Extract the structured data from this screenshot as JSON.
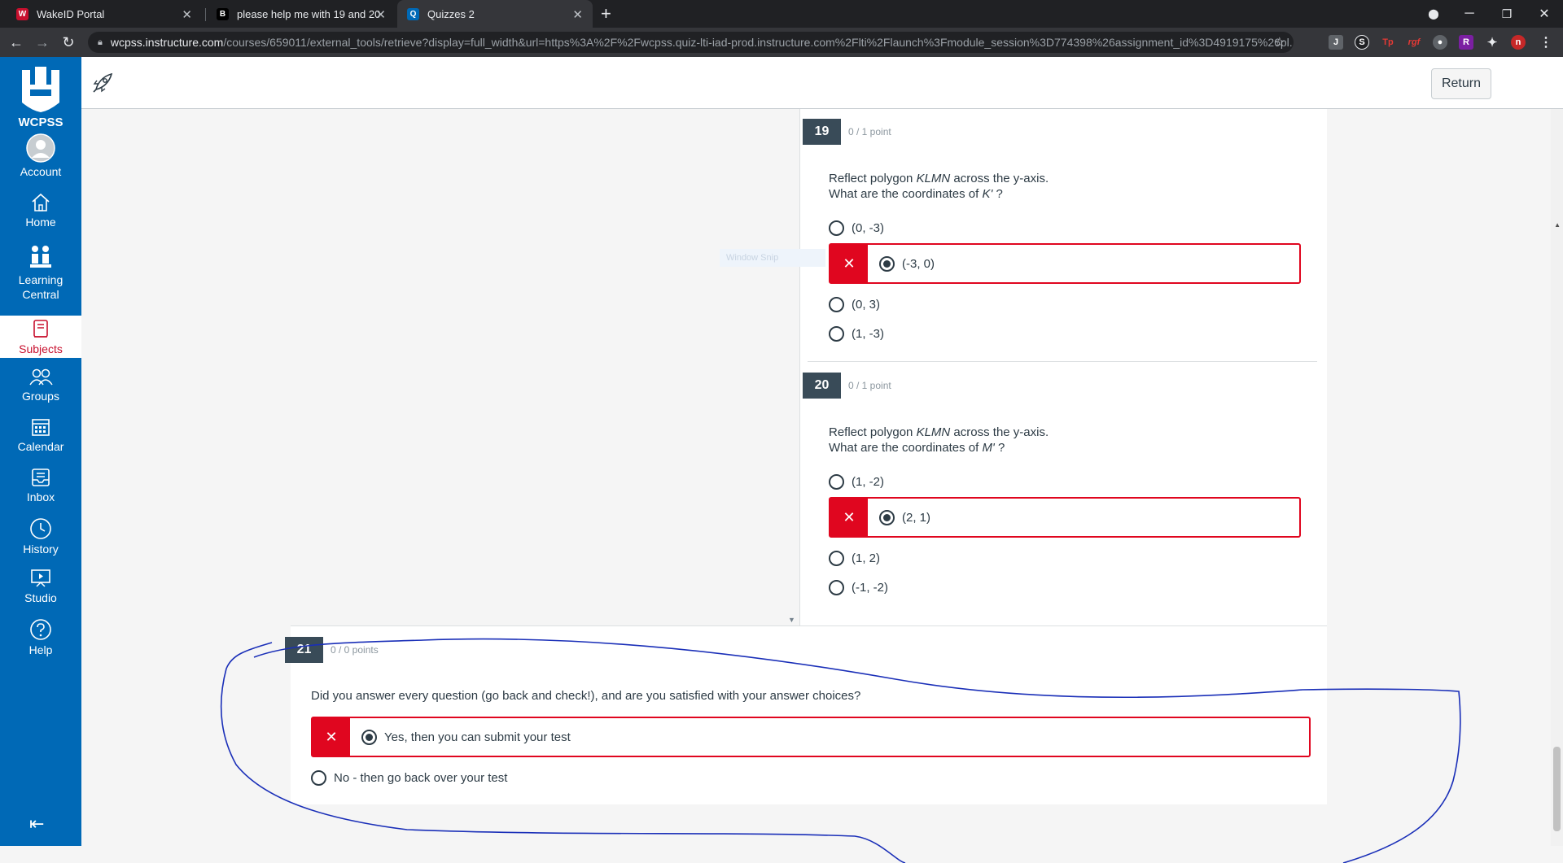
{
  "browser": {
    "tabs": [
      {
        "title": "WakeID Portal",
        "favicon": "W"
      },
      {
        "title": "please help me with 19 and 20 -",
        "favicon": "B"
      },
      {
        "title": "Quizzes 2",
        "favicon": "Q"
      }
    ],
    "url_host": "wcpss.instructure.com",
    "url_path": "/courses/659011/external_tools/retrieve?display=full_width&url=https%3A%2F%2Fwcpss.quiz-lti-iad-prod.instructure.com%2Flti%2Flaunch%3Fmodule_session%3D774398%26assignment_id%3D4919175%26pl...",
    "extensions": [
      "J",
      "S",
      "Tp",
      "rgf",
      "●",
      "R",
      "✦",
      "n"
    ]
  },
  "gnav": {
    "logo_text": "WCPSS",
    "items": [
      {
        "label": "Account",
        "icon": "account-icon"
      },
      {
        "label": "Home",
        "icon": "home-icon"
      },
      {
        "label": "Learning Central",
        "icon": "learning-central-icon"
      },
      {
        "label": "Subjects",
        "icon": "subjects-icon"
      },
      {
        "label": "Groups",
        "icon": "groups-icon"
      },
      {
        "label": "Calendar",
        "icon": "calendar-icon"
      },
      {
        "label": "Inbox",
        "icon": "inbox-icon"
      },
      {
        "label": "History",
        "icon": "history-icon"
      },
      {
        "label": "Studio",
        "icon": "studio-icon"
      },
      {
        "label": "Help",
        "icon": "help-icon"
      }
    ],
    "active": "Subjects"
  },
  "topbar": {
    "return_label": "Return"
  },
  "snip_overlay": "Window Snip",
  "questions": [
    {
      "number": "19",
      "points": "0 / 1 point",
      "line1_pre": "Reflect polygon ",
      "line1_em": "KLMN",
      "line1_post": " across the y-axis.",
      "line2_pre": "What are the coordinates of ",
      "line2_em": "K'",
      "line2_post": " ?",
      "options": [
        "(0, -3)",
        "(-3, 0)",
        "(0, 3)",
        "(1, -3)"
      ],
      "selected_index": 1,
      "selected_correct": false
    },
    {
      "number": "20",
      "points": "0 / 1 point",
      "line1_pre": "Reflect polygon ",
      "line1_em": "KLMN",
      "line1_post": " across the y-axis.",
      "line2_pre": "What are the coordinates of ",
      "line2_em": "M'",
      "line2_post": " ?",
      "options": [
        "(1, -2)",
        "(2, 1)",
        "(1, 2)",
        "(-1, -2)"
      ],
      "selected_index": 1,
      "selected_correct": false
    },
    {
      "number": "21",
      "points": "0 / 0 points",
      "text": "Did you answer every question (go back and check!), and are you satisfied with your answer choices?",
      "options": [
        "Yes, then you can submit your test",
        "No - then go back over your test"
      ],
      "selected_index": 0,
      "selected_correct": false
    }
  ],
  "colors": {
    "nav_blue": "#0069b6",
    "wrong_red": "#e0061f",
    "qnum_bg": "#394b58",
    "annotation_ink": "#1a2fb8"
  }
}
